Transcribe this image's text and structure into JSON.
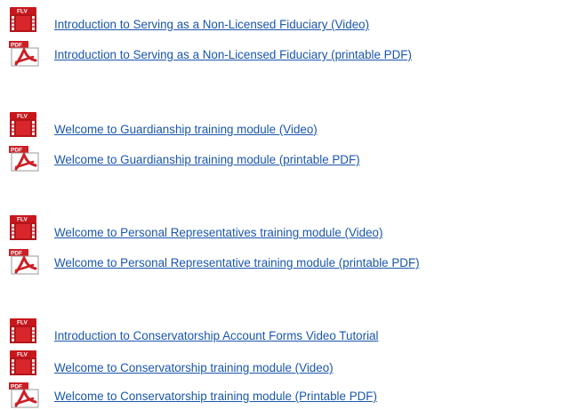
{
  "colors": {
    "link": "#1a56ad",
    "flv_icon": "#c8171c",
    "pdf_icon": "#cc1f26"
  },
  "icon_labels": {
    "flv": "FLV",
    "pdf": "PDF"
  },
  "items": [
    {
      "type": "flv",
      "icon": "flv-video-icon",
      "label": "Introduction to Serving as a Non-Licensed Fiduciary (Video)"
    },
    {
      "type": "pdf",
      "icon": "pdf-document-icon",
      "label": "Introduction to Serving as a Non-Licensed Fiduciary (printable PDF)"
    },
    {
      "type": "flv",
      "icon": "flv-video-icon",
      "label": "Welcome to Guardianship training module (Video)"
    },
    {
      "type": "pdf",
      "icon": "pdf-document-icon",
      "label": "Welcome to Guardianship training module (printable PDF)"
    },
    {
      "type": "flv",
      "icon": "flv-video-icon",
      "label": "Welcome to Personal Representatives training module (Video)"
    },
    {
      "type": "pdf",
      "icon": "pdf-document-icon",
      "label": "Welcome to Personal Representative training module (printable PDF)"
    },
    {
      "type": "flv",
      "icon": "flv-video-icon",
      "label": "Introduction to Conservatorship Account Forms Video Tutorial "
    },
    {
      "type": "flv",
      "icon": "flv-video-icon",
      "label": "Welcome to Conservatorship training module  (Video)"
    },
    {
      "type": "pdf",
      "icon": "pdf-document-icon",
      "label": "Welcome to Conservatorship training module (Printable PDF)"
    }
  ]
}
